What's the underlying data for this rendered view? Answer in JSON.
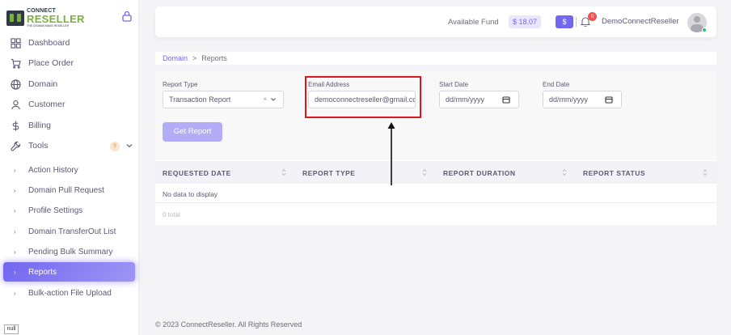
{
  "brand": {
    "line1": "CONNECT",
    "line2": "RESELLER",
    "tagline": "THE DOMAIN MAKE RESELLER"
  },
  "sidebar": {
    "items": [
      {
        "label": "Dashboard",
        "icon": "grid-icon"
      },
      {
        "label": "Place Order",
        "icon": "cart-icon"
      },
      {
        "label": "Domain",
        "icon": "globe-icon"
      },
      {
        "label": "Customer",
        "icon": "user-icon"
      },
      {
        "label": "Billing",
        "icon": "dollar-icon"
      },
      {
        "label": "Tools",
        "icon": "wrench-icon",
        "badge": "9"
      }
    ],
    "subitems": [
      {
        "label": "Action History"
      },
      {
        "label": "Domain Pull Request"
      },
      {
        "label": "Profile Settings"
      },
      {
        "label": "Domain TransferOut List"
      },
      {
        "label": "Pending Bulk Summary"
      },
      {
        "label": "Reports",
        "active": true
      },
      {
        "label": "Bulk-action File Upload"
      }
    ],
    "null_tag": "null"
  },
  "header": {
    "fund_label": "Available Fund",
    "fund_value": "$ 18.07",
    "dollar_button": "$",
    "notification_count": "0",
    "user_name": "DemoConnectReseller"
  },
  "breadcrumb": {
    "parent": "Domain",
    "separator": ">",
    "current": "Reports"
  },
  "filters": {
    "report_type_label": "Report Type",
    "report_type_value": "Transaction Report",
    "email_label": "Email Address",
    "email_value": "democonnectreseller@gmail.com",
    "start_date_label": "Start Date",
    "start_date_placeholder": "dd/mm/yyyy",
    "end_date_label": "End Date",
    "end_date_placeholder": "dd/mm/yyyy",
    "get_report_label": "Get Report"
  },
  "table": {
    "columns": [
      "REQUESTED DATE",
      "REPORT TYPE",
      "REPORT DURATION",
      "REPORT STATUS"
    ],
    "empty_text": "No data to display",
    "total_text": "0 total"
  },
  "footer": {
    "text": "© 2023 ConnectReseller. All Rights Reserved"
  },
  "colors": {
    "accent": "#7367f0",
    "highlight": "#e0141e",
    "brand_green": "#7bb13a"
  }
}
